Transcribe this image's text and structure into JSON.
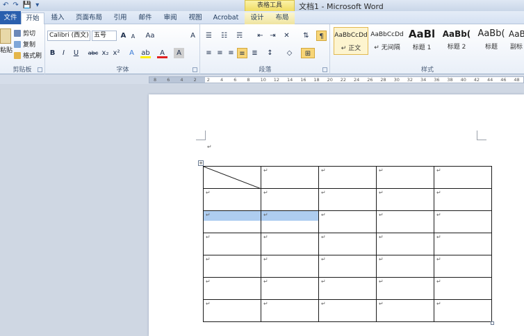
{
  "window": {
    "title": "文档1 - Microsoft Word",
    "context_tab_group": "表格工具"
  },
  "qat": {
    "undo": "↶",
    "redo": "↷",
    "save": "💾",
    "more": "▾"
  },
  "tabs": [
    {
      "label": "文件"
    },
    {
      "label": "开始"
    },
    {
      "label": "插入"
    },
    {
      "label": "页面布局"
    },
    {
      "label": "引用"
    },
    {
      "label": "邮件"
    },
    {
      "label": "审阅"
    },
    {
      "label": "视图"
    },
    {
      "label": "Acrobat"
    },
    {
      "label": "设计"
    },
    {
      "label": "布局"
    }
  ],
  "clipboard": {
    "paste": "粘贴",
    "cut": "剪切",
    "copy": "复制",
    "format_painter": "格式刷",
    "group_label": "剪贴板"
  },
  "font": {
    "name": "Calibri (西文)",
    "size": "五号",
    "grow": "A",
    "shrink": "A",
    "case": "Aa",
    "clear": "A",
    "bold": "B",
    "italic": "I",
    "underline": "U",
    "strike": "abc",
    "sub": "x₂",
    "sup": "x²",
    "effects": "A",
    "highlight": "ab",
    "color": "A",
    "shade": "A",
    "border": "A",
    "group_label": "字体"
  },
  "paragraph": {
    "group_label": "段落"
  },
  "styles": {
    "group_label": "样式",
    "items": [
      {
        "preview": "AaBbCcDd",
        "name": "↵ 正文"
      },
      {
        "preview": "AaBbCcDd",
        "name": "↵ 无间隔"
      },
      {
        "preview": "AaBl",
        "name": "标题 1"
      },
      {
        "preview": "AaBb(",
        "name": "标题 2"
      },
      {
        "preview": "AaBb(",
        "name": "标题"
      },
      {
        "preview": "AaB",
        "name": "副标"
      }
    ]
  },
  "ruler": {
    "labels": [
      "8",
      "6",
      "4",
      "2",
      "2",
      "4",
      "6",
      "8",
      "10",
      "12",
      "14",
      "16",
      "18",
      "20",
      "22",
      "24",
      "26",
      "28",
      "30",
      "32",
      "34",
      "36",
      "38",
      "40",
      "42",
      "44",
      "46",
      "48"
    ]
  },
  "document": {
    "para_mark": "↵",
    "table": {
      "rows": 7,
      "cols": 5,
      "cell_mark": "↵",
      "move_handle": "+"
    }
  }
}
